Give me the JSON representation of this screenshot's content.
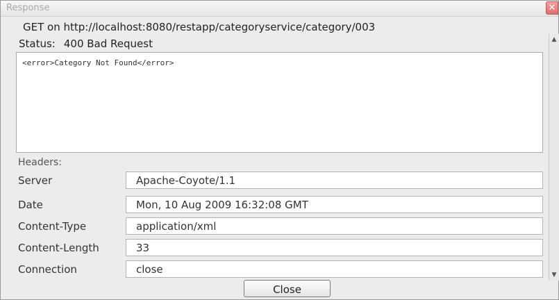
{
  "window": {
    "title": "Response",
    "close_icon": "close-icon"
  },
  "request": {
    "line": "GET on http://localhost:8080/restapp/categoryservice/category/003"
  },
  "status": {
    "label": "Status:",
    "value": "400 Bad Request"
  },
  "body": {
    "text": "<error>Category Not Found</error>"
  },
  "headers": {
    "label": "Headers:",
    "rows": [
      {
        "name": "Server",
        "value": "Apache-Coyote/1.1"
      },
      {
        "name": "Date",
        "value": "Mon, 10 Aug 2009 16:32:08 GMT"
      },
      {
        "name": "Content-Type",
        "value": "application/xml"
      },
      {
        "name": "Content-Length",
        "value": "33"
      },
      {
        "name": "Connection",
        "value": "close"
      }
    ]
  },
  "footer": {
    "close_label": "Close"
  },
  "colors": {
    "window_bg": "#ececec",
    "close_x_bg": "#e06e6e"
  }
}
